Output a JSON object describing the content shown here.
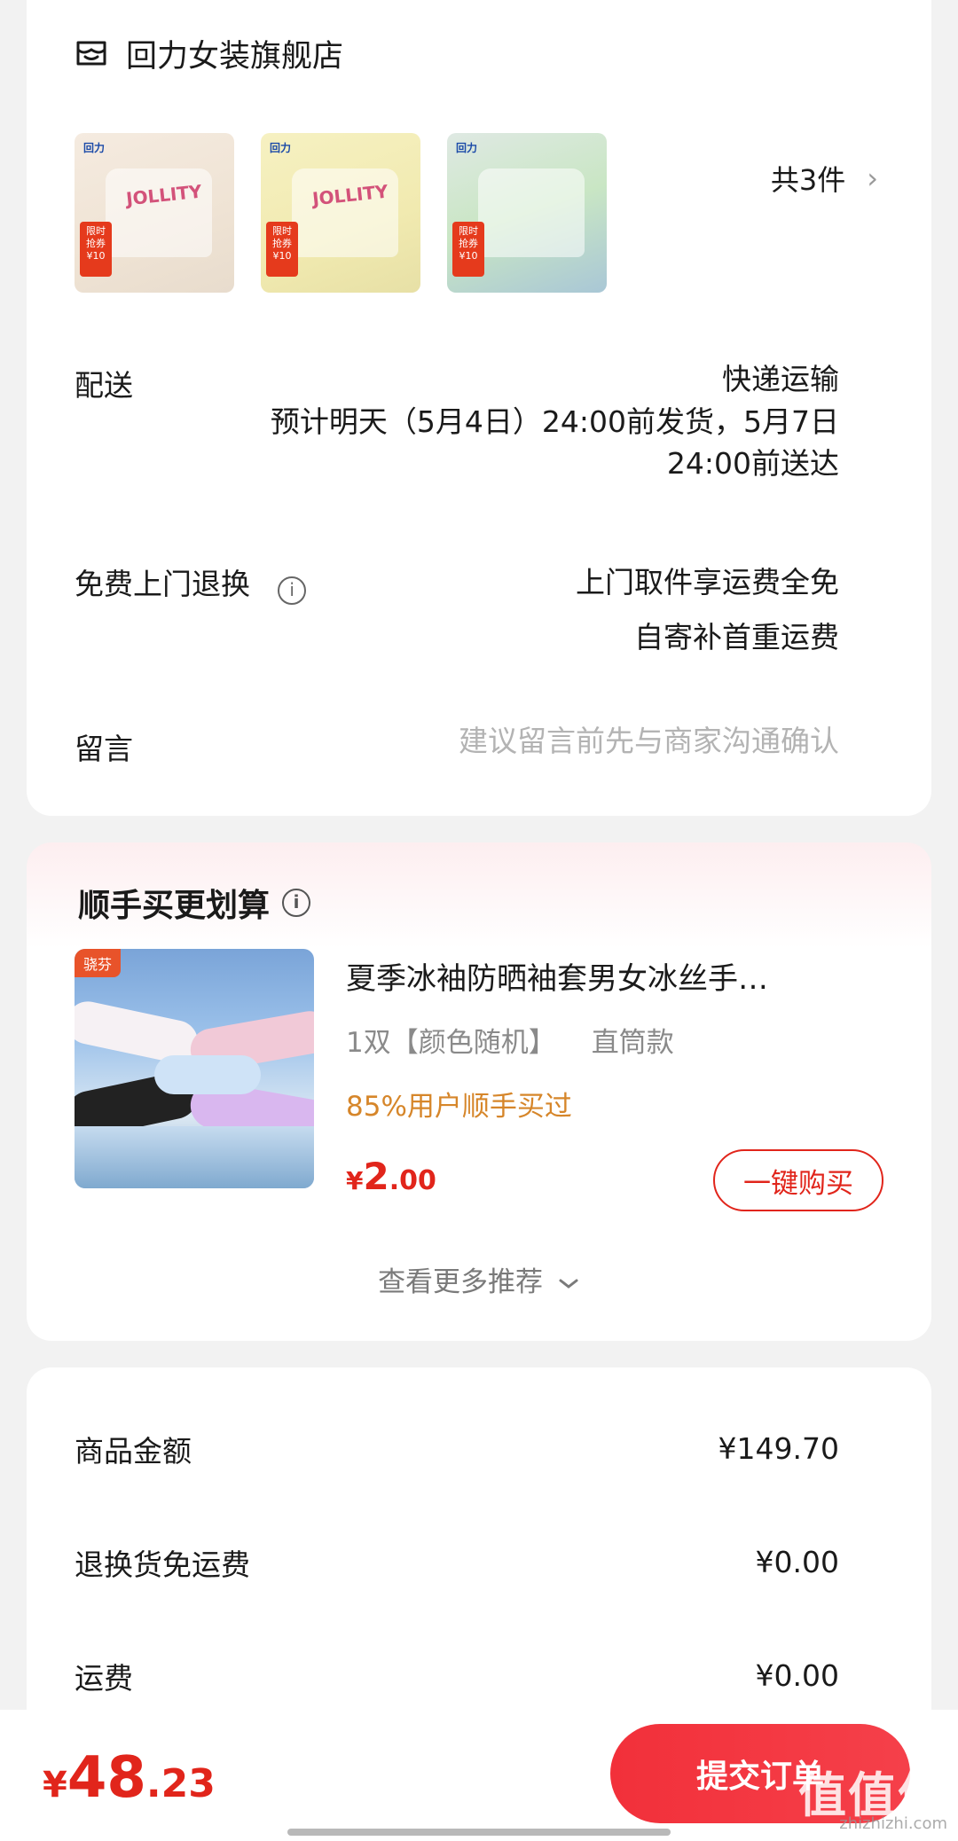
{
  "store": {
    "name": "回力女装旗舰店",
    "thumbnails": [
      {
        "logo": "回力",
        "brand": "JOLLITY",
        "tag": "限时 抢券 ¥10"
      },
      {
        "logo": "回力",
        "brand": "JOLLITY",
        "tag": "限时 抢券 ¥10"
      },
      {
        "logo": "回力",
        "brand": "",
        "tag": "限时 抢券 ¥10"
      }
    ],
    "item_count": "共3件",
    "delivery_label": "配送",
    "delivery_method": "快递运输",
    "delivery_eta_line1": "预计明天（5月4日）24:00前发货，5月7日",
    "delivery_eta_line2": "24:00前送达",
    "return_label": "免费上门退换",
    "return_line1": "上门取件享运费全免",
    "return_line2": "自寄补首重运费",
    "message_label": "留言",
    "message_placeholder": "建议留言前先与商家沟通确认"
  },
  "addon": {
    "title": "顺手买更划算",
    "image_brand": "骁芬",
    "product_name": "夏季冰袖防晒袖套男女冰丝手…",
    "spec_qty": "1双【颜色随机】",
    "spec_style": "直筒款",
    "social_proof": "85%用户顺手买过",
    "price_currency": "¥",
    "price_int": "2",
    "price_dec": ".00",
    "buy_label": "一键购买",
    "more_label": "查看更多推荐"
  },
  "summary": {
    "rows": [
      {
        "label": "商品金额",
        "value": "¥149.70"
      },
      {
        "label": "退换货免运费",
        "value": "¥0.00"
      },
      {
        "label": "运费",
        "value": "¥0.00"
      }
    ]
  },
  "footer": {
    "total_currency": "¥",
    "total_int": "48",
    "total_dec": ".23",
    "submit_label": "提交订单",
    "watermark": "值值值",
    "watermark_site": "zhizhizhi.com"
  },
  "colors": {
    "accent_red": "#e1251b",
    "social_orange": "#d6862a",
    "page_bg": "#f2f2f2"
  }
}
